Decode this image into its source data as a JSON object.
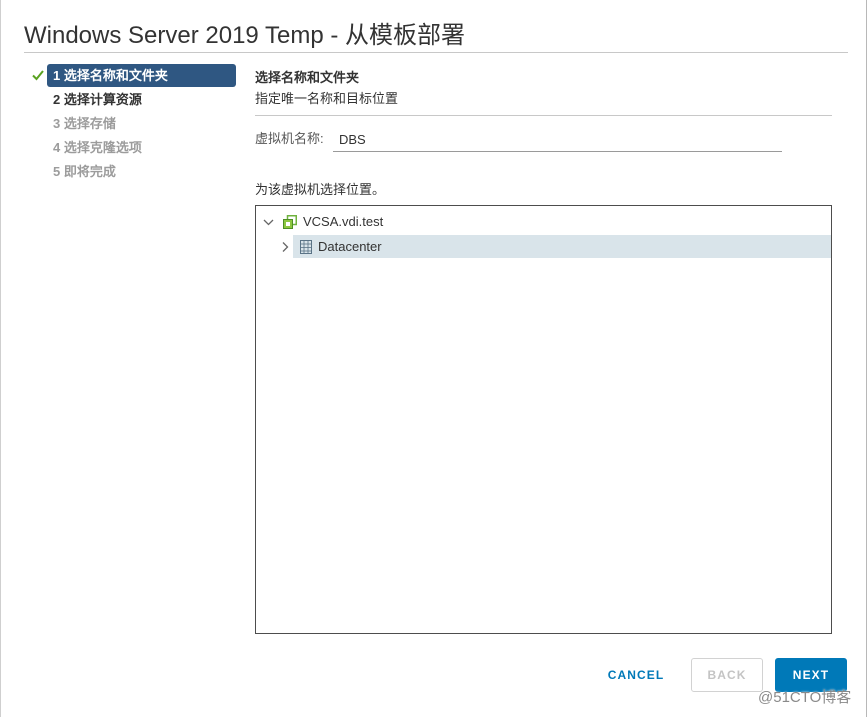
{
  "dialog": {
    "title": "Windows Server 2019 Temp - 从模板部署"
  },
  "steps": [
    {
      "label": "1 选择名称和文件夹",
      "current": true,
      "completed": true,
      "enabled": true
    },
    {
      "label": "2 选择计算资源",
      "current": false,
      "completed": false,
      "enabled": true
    },
    {
      "label": "3 选择存储",
      "current": false,
      "completed": false,
      "enabled": false
    },
    {
      "label": "4 选择克隆选项",
      "current": false,
      "completed": false,
      "enabled": false
    },
    {
      "label": "5 即将完成",
      "current": false,
      "completed": false,
      "enabled": false
    }
  ],
  "page": {
    "heading": "选择名称和文件夹",
    "description": "指定唯一名称和目标位置",
    "vm_name": {
      "label": "虚拟机名称:",
      "value": "DBS"
    },
    "location_prompt": "为该虚拟机选择位置。"
  },
  "tree": {
    "nodes": [
      {
        "label": "VCSA.vdi.test",
        "icon": "vcenter-icon",
        "expanded": true,
        "selected": false
      },
      {
        "label": "Datacenter",
        "icon": "datacenter-icon",
        "expanded": false,
        "selected": true
      }
    ]
  },
  "footer": {
    "cancel_label": "CANCEL",
    "back_label": "BACK",
    "back_enabled": false,
    "next_label": "NEXT"
  },
  "watermark": "@51CTO博客",
  "icons": {
    "step_complete": "check-icon",
    "expanded": "chevron-down-icon",
    "collapsed": "chevron-right-icon"
  },
  "colors": {
    "accent": "#0079b8",
    "current_step_bg": "#2f5782",
    "step_complete_check": "#5aa220",
    "selected_row_bg": "#d9e4ea",
    "disabled_text": "#9c9c9c"
  }
}
